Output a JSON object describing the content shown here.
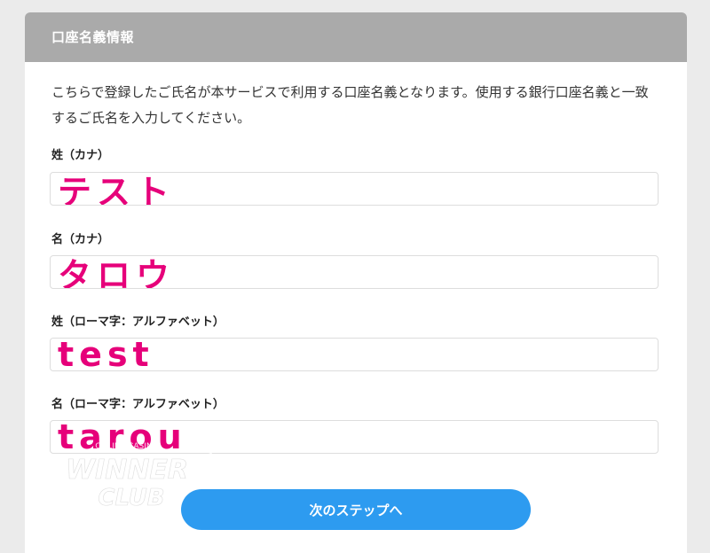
{
  "section": {
    "title": "口座名義情報",
    "intro": "こちらで登録したご氏名が本サービスで利用する口座名義となります。使用する銀行口座名義と一致するご氏名を入力してください。"
  },
  "fields": [
    {
      "label": "姓（カナ）",
      "value": "テスト"
    },
    {
      "label": "名（カナ）",
      "value": "タロウ"
    },
    {
      "label": "姓（ローマ字：アルファベット）",
      "value": "test"
    },
    {
      "label": "名（ローマ字：アルファベット）",
      "value": "tarou"
    }
  ],
  "submit": {
    "label": "次のステップへ"
  },
  "watermark": {
    "line1": "WINNER",
    "line2": "CLUB",
    "arc": "ONLINE CASINO"
  },
  "colors": {
    "accent": "#2d9bf0",
    "header": "#aaaaaa",
    "input_text": "#e6007a"
  }
}
